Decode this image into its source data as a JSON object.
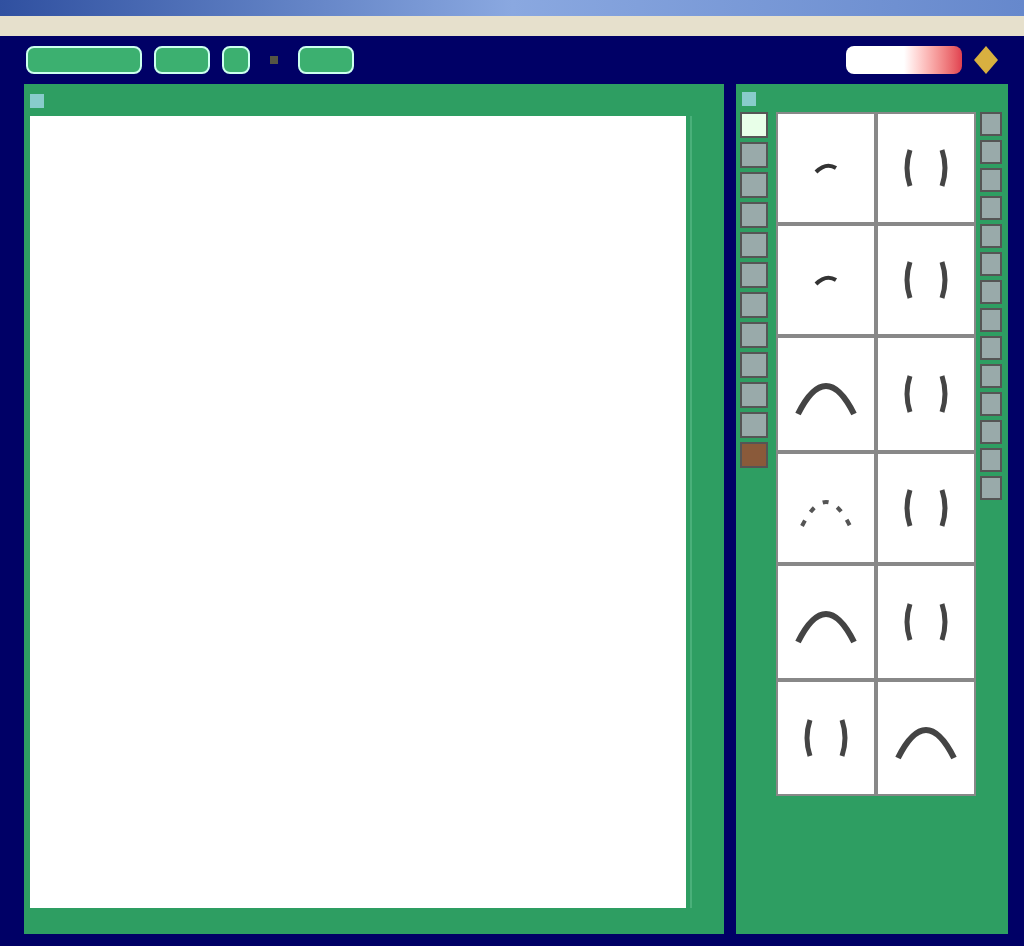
{
  "thumbnails": [
    {
      "kind": "dash"
    },
    {
      "kind": "brackets"
    },
    {
      "kind": "dash"
    },
    {
      "kind": "brackets"
    },
    {
      "kind": "arc"
    },
    {
      "kind": "brackets"
    },
    {
      "kind": "dotted-arc"
    },
    {
      "kind": "brackets"
    },
    {
      "kind": "arc"
    },
    {
      "kind": "brackets"
    },
    {
      "kind": "brackets"
    },
    {
      "kind": "arc"
    }
  ]
}
